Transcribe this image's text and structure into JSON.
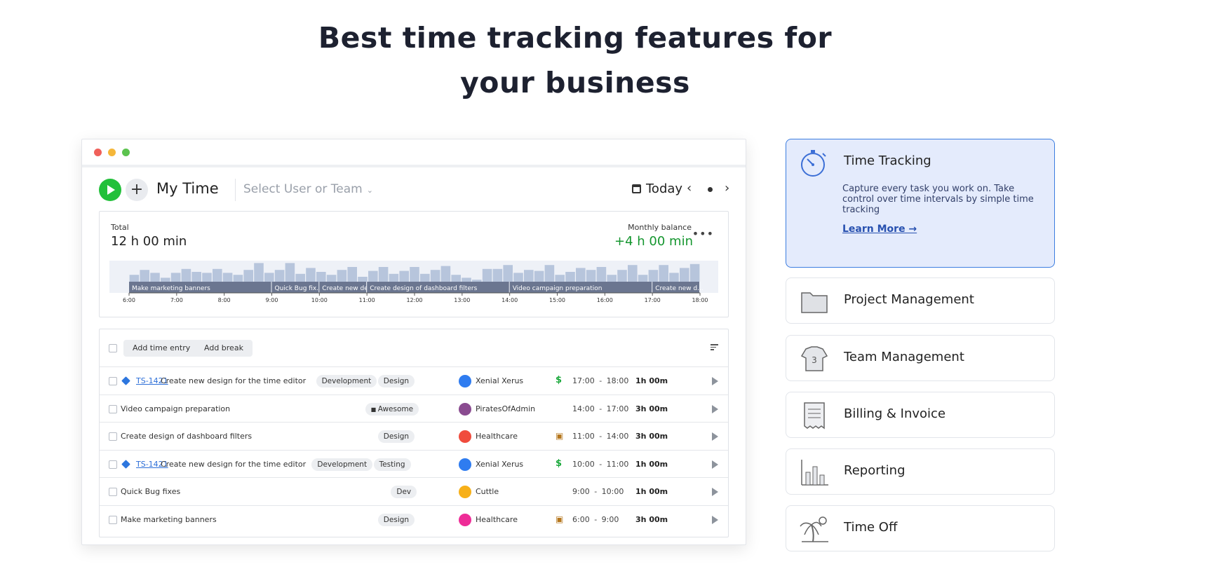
{
  "hero": {
    "title_line1": "Best time tracking features for",
    "title_line2": "your business"
  },
  "toolbar": {
    "title": "My Time",
    "user_select_placeholder": "Select User or Team",
    "date_label": "Today"
  },
  "summary": {
    "total_label": "Total",
    "total_value": "12 h 00 min",
    "balance_label": "Monthly balance",
    "balance_value": "+4 h 00 min"
  },
  "chart_data": {
    "type": "bar",
    "x_ticks": [
      "6:00",
      "7:00",
      "8:00",
      "9:00",
      "10:00",
      "11:00",
      "12:00",
      "13:00",
      "14:00",
      "15:00",
      "16:00",
      "17:00",
      "18:00"
    ],
    "activity_values": [
      0.35,
      0.6,
      0.45,
      0.2,
      0.45,
      0.65,
      0.5,
      0.45,
      0.65,
      0.45,
      0.35,
      0.6,
      0.95,
      0.45,
      0.6,
      0.95,
      0.4,
      0.7,
      0.5,
      0.35,
      0.6,
      0.75,
      0.25,
      0.55,
      0.75,
      0.4,
      0.55,
      0.75,
      0.4,
      0.6,
      0.8,
      0.35,
      0.2,
      0.1,
      0.65,
      0.65,
      0.85,
      0.45,
      0.6,
      0.55,
      0.85,
      0.35,
      0.5,
      0.7,
      0.6,
      0.75,
      0.35,
      0.6,
      0.85,
      0.35,
      0.6,
      0.85,
      0.45,
      0.7,
      0.9
    ],
    "segments": [
      {
        "label": "Make marketing banners",
        "start": "6:00",
        "end": "9:00"
      },
      {
        "label": "Quick Bug fix...",
        "start": "9:00",
        "end": "10:00"
      },
      {
        "label": "Create new de...",
        "start": "10:00",
        "end": "11:00"
      },
      {
        "label": "Create design of dashboard filters",
        "start": "11:00",
        "end": "14:00"
      },
      {
        "label": "Video campaign preparation",
        "start": "14:00",
        "end": "17:00"
      },
      {
        "label": "Create new d...",
        "start": "17:00",
        "end": "18:00"
      }
    ]
  },
  "entries": {
    "add_time_label": "Add time entry",
    "add_break_label": "Add break",
    "rows": [
      {
        "id": "TS-1421",
        "name": "Create new design for the time editor",
        "tags": [
          "Development",
          "Design"
        ],
        "client": "Xenial Xerus",
        "color": "#2f7cf0",
        "billing": "money",
        "start": "17:00",
        "end": "18:00",
        "duration": "1h 00m"
      },
      {
        "id": "",
        "name": "Video campaign preparation",
        "tags": [
          "Awesome"
        ],
        "client": "PiratesOfAdmin",
        "color": "#8a4b90",
        "billing": "",
        "start": "14:00",
        "end": "17:00",
        "duration": "3h 00m"
      },
      {
        "id": "",
        "name": "Create design of dashboard filters",
        "tags": [
          "Design"
        ],
        "client": "Healthcare",
        "color": "#f04c3d",
        "billing": "lock",
        "start": "11:00",
        "end": "14:00",
        "duration": "3h 00m"
      },
      {
        "id": "TS-1421",
        "name": "Create new design for the time editor",
        "tags": [
          "Development",
          "Testing"
        ],
        "client": "Xenial Xerus",
        "color": "#2f7cf0",
        "billing": "money",
        "start": "10:00",
        "end": "11:00",
        "duration": "1h 00m"
      },
      {
        "id": "",
        "name": "Quick Bug fixes",
        "tags": [
          "Dev"
        ],
        "client": "Cuttle",
        "color": "#f7b019",
        "billing": "",
        "start": "9:00",
        "end": "10:00",
        "duration": "1h 00m"
      },
      {
        "id": "",
        "name": "Make marketing banners",
        "tags": [
          "Design"
        ],
        "client": "Healthcare",
        "color": "#ee2c97",
        "billing": "lock",
        "start": "6:00",
        "end": "9:00",
        "duration": "3h 00m"
      }
    ]
  },
  "features": [
    {
      "title": "Time Tracking",
      "icon": "stopwatch-icon",
      "active": true,
      "description": "Capture every task you work on. Take control over time intervals by simple time tracking",
      "link": "Learn More →"
    },
    {
      "title": "Project Management",
      "icon": "folder-icon",
      "active": false
    },
    {
      "title": "Team Management",
      "icon": "team-shirt-icon",
      "active": false
    },
    {
      "title": "Billing & Invoice",
      "icon": "receipt-icon",
      "active": false
    },
    {
      "title": "Reporting",
      "icon": "bar-chart-icon",
      "active": false
    },
    {
      "title": "Time Off",
      "icon": "palm-tree-icon",
      "active": false
    }
  ]
}
